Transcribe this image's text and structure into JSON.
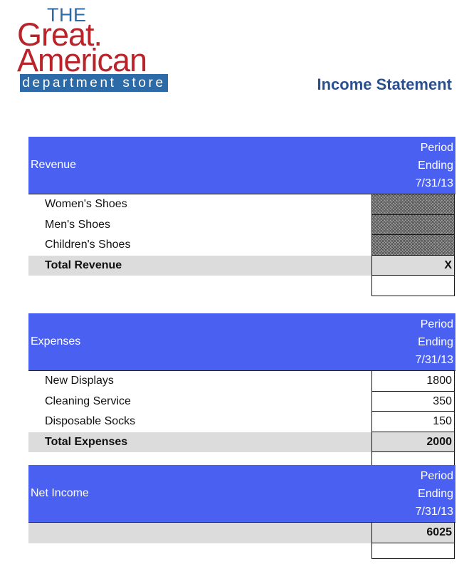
{
  "logo": {
    "line1": "THE",
    "line2": "Great.",
    "line3": "American",
    "line4": "department store"
  },
  "document": {
    "title": "Income Statement"
  },
  "period_header": {
    "line1": "Period",
    "line2": "Ending",
    "line3": "7/31/13"
  },
  "revenue": {
    "title": "Revenue",
    "items": [
      {
        "label": "Women's Shoes",
        "value": ""
      },
      {
        "label": "Men's Shoes",
        "value": ""
      },
      {
        "label": "Children's Shoes",
        "value": ""
      }
    ],
    "total_label": "Total Revenue",
    "total_value": "X"
  },
  "expenses": {
    "title": "Expenses",
    "items": [
      {
        "label": "New Displays",
        "value": "1800"
      },
      {
        "label": "Cleaning Service",
        "value": "350"
      },
      {
        "label": "Disposable Socks",
        "value": "150"
      }
    ],
    "total_label": "Total Expenses",
    "total_value": "2000"
  },
  "net_income": {
    "title": "Net Income",
    "value": "6025"
  },
  "colors": {
    "header_blue": "#4a60f0",
    "logo_red": "#b8242a",
    "logo_blue": "#2c6aa8",
    "title_blue": "#2a4f8f",
    "total_gray": "#dcdcdc"
  }
}
